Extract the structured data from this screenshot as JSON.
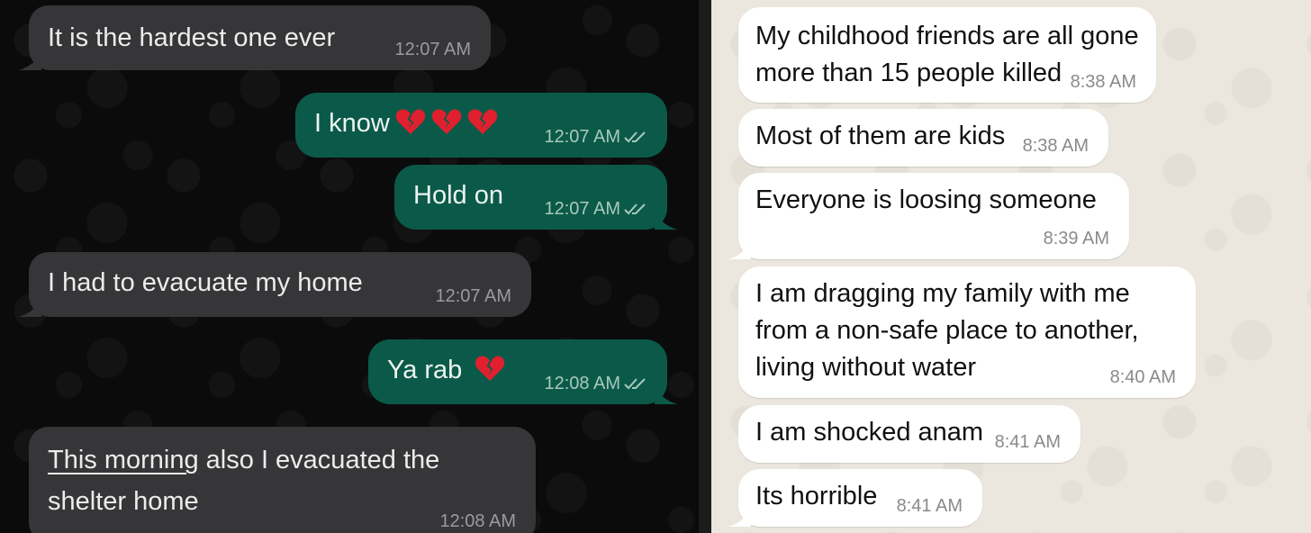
{
  "colors": {
    "left_bg": "#0b0b0b",
    "incoming_dark": "#363638",
    "outgoing_dark": "#0b5a49",
    "right_bg": "#ebe7df",
    "incoming_light": "#ffffff",
    "heart": "#e0202e"
  },
  "icons": {
    "read_receipt": "double-check-icon",
    "emoji": "broken-heart-icon"
  },
  "left_chat": {
    "messages": [
      {
        "text": "It is the hardest one ever",
        "time": "12:07 AM"
      },
      {
        "text": "I know",
        "time": "12:07 AM"
      },
      {
        "text": "Hold on",
        "time": "12:07 AM"
      },
      {
        "text": "I had to evacuate my home",
        "time": "12:07 AM"
      },
      {
        "text": "Ya rab",
        "time": "12:08 AM"
      },
      {
        "line1_underlined": "This morning",
        "line1_rest": " also I evacuated the",
        "line2": "shelter home",
        "time": "12:08 AM"
      }
    ]
  },
  "right_chat": {
    "messages": [
      {
        "line1": "My childhood friends are all gone",
        "line2": "more than 15 people killed",
        "time": "8:38 AM"
      },
      {
        "text": "Most of them are kids",
        "time": "8:38 AM"
      },
      {
        "text": "Everyone is loosing someone",
        "time": "8:39 AM"
      },
      {
        "line1": "I am dragging my family with me",
        "line2": "from a non-safe place to another,",
        "line3": "living without water",
        "time": "8:40 AM"
      },
      {
        "text": "I am shocked anam",
        "time": "8:41 AM"
      },
      {
        "text": "Its horrible",
        "time": "8:41 AM"
      }
    ]
  }
}
